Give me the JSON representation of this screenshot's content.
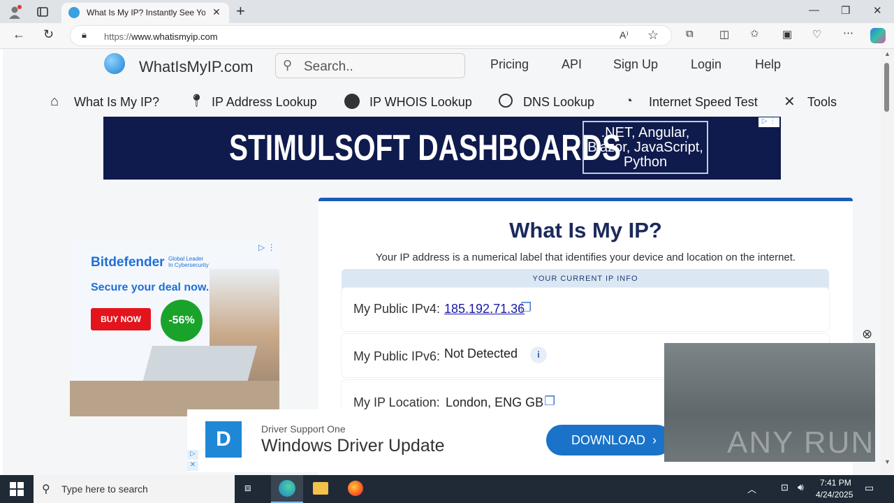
{
  "browser": {
    "tab_title": "What Is My IP? Instantly See Your",
    "new_tab_symbol": "+",
    "url_prefix": "https://",
    "url_host": "www.whatismyip.com",
    "read_aloud_label": "A⁾",
    "icons": [
      "profile-icon",
      "tab-actions-icon",
      "back-icon",
      "refresh-icon",
      "lock-icon",
      "favorite-icon",
      "extensions-icon",
      "split-screen-icon",
      "favorites-icon",
      "collections-icon",
      "browser-essentials-icon",
      "more-icon",
      "copilot-icon",
      "minimize-icon",
      "maximize-icon",
      "close-icon"
    ]
  },
  "site": {
    "logo_text": "WhatIsMyIP.com",
    "search_placeholder": "Search..",
    "top_links": [
      "Pricing",
      "API",
      "Sign Up",
      "Login",
      "Help"
    ],
    "nav": [
      "What Is My IP?",
      "IP Address Lookup",
      "IP WHOIS Lookup",
      "DNS Lookup",
      "Internet Speed Test",
      "Tools"
    ]
  },
  "banner_ad": {
    "title": "STIMULSOFT DASHBOARDS",
    "box_lines": [
      ".NET, Angular,",
      "Blazor, JavaScript,",
      "Python"
    ]
  },
  "side_ad": {
    "brand": "Bitdefender",
    "brand_tag_1": "Global Leader",
    "brand_tag_2": "In Cybersecurity",
    "headline": "Secure your deal now.",
    "cta": "BUY NOW",
    "discount": "-56%"
  },
  "main": {
    "title": "What Is My IP?",
    "subtitle": "Your IP address is a numerical label that identifies your device and location on the internet.",
    "info_header": "YOUR CURRENT IP INFO",
    "rows": [
      {
        "label": "My Public IPv4:",
        "value": "185.192.71.36"
      },
      {
        "label": "My Public IPv6:",
        "value": "Not Detected"
      },
      {
        "label": "My IP Location:",
        "value": "London, ENG GB"
      }
    ]
  },
  "bottom_ad": {
    "brand": "Driver Support One",
    "headline": "Windows Driver Update",
    "cta": "DOWNLOAD"
  },
  "video": {
    "watermark": "ANY RUN",
    "close_symbol": "⊗"
  },
  "taskbar": {
    "search_placeholder": "Type here to search",
    "time": "7:41 PM",
    "date": "4/24/2025"
  },
  "colors": {
    "accent": "#1c5cb8",
    "banner_bg": "#0f1a4d",
    "download_btn": "#1a73c9",
    "buy_now": "#e3141c",
    "discount": "#1aa32a"
  }
}
